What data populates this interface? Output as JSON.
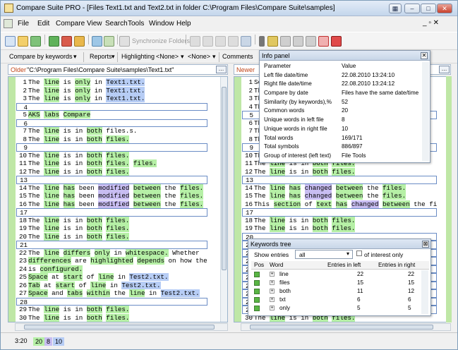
{
  "window": {
    "title": "Compare Suite PRO - [Files Text1.txt and Text2.txt in folder C:\\Program Files\\Compare Suite\\samples]"
  },
  "menu": [
    "File",
    "Edit",
    "Compare",
    "View",
    "Search",
    "Tools",
    "Window",
    "Help"
  ],
  "toolbar": {
    "sync_label": "Synchronize Folders"
  },
  "toolbar2": {
    "compare_by": "Compare by keywords",
    "reports": "Reports",
    "highlighting": "Highlighting",
    "none1": "<None>",
    "none2": "<None>",
    "comments": "Comments"
  },
  "left_path": {
    "label": "Older",
    "path": "\"C:\\Program Files\\Compare Suite\\samples\\Text1.txt\""
  },
  "right_path": {
    "label": "Newer"
  },
  "left_lines": [
    {
      "n": "1",
      "t": "The line is only in Text1.txt."
    },
    {
      "n": "2",
      "t": "The line is only in Text1.txt."
    },
    {
      "n": "3",
      "t": "The line is only in Text1.txt."
    },
    {
      "n": "4",
      "t": ""
    },
    {
      "n": "5",
      "t": "AKS labs Compare"
    },
    {
      "n": "6",
      "t": ""
    },
    {
      "n": "7",
      "t": "The line is in both files.s."
    },
    {
      "n": "8",
      "t": "The line is in both files."
    },
    {
      "n": "9",
      "t": ""
    },
    {
      "n": "10",
      "t": "The line is in both files."
    },
    {
      "n": "11",
      "t": "The line is in both files. files."
    },
    {
      "n": "12",
      "t": "The line is in both files."
    },
    {
      "n": "13",
      "t": ""
    },
    {
      "n": "14",
      "t": "The line has been modified between the files."
    },
    {
      "n": "15",
      "t": "The line has been modified between the files."
    },
    {
      "n": "16",
      "t": "The line has been modified between the files."
    },
    {
      "n": "17",
      "t": ""
    },
    {
      "n": "18",
      "t": "The line is in both files."
    },
    {
      "n": "19",
      "t": "The line is in both files."
    },
    {
      "n": "20",
      "t": "The line is in both files."
    },
    {
      "n": "21",
      "t": ""
    },
    {
      "n": "22",
      "t": "The line differs only in whitespace. Whether"
    },
    {
      "n": "23",
      "t": "differences are highlighted depends on how the"
    },
    {
      "n": "24",
      "t": "is configured."
    },
    {
      "n": "25",
      "t": "Space at start of line in Test2.txt."
    },
    {
      "n": "26",
      "t": "Tab at start of line in Test2.txt."
    },
    {
      "n": "27",
      "t": "Space and tabs within the line in Test2.txt."
    },
    {
      "n": "28",
      "t": ""
    },
    {
      "n": "29",
      "t": "The line is in both files."
    },
    {
      "n": "30",
      "t": "The line is in both files."
    }
  ],
  "right_lines": [
    {
      "n": "1",
      "t": "Sec"
    },
    {
      "n": "2",
      "t": "The"
    },
    {
      "n": "3",
      "t": "The"
    },
    {
      "n": "4",
      "t": "The"
    },
    {
      "n": "5",
      "t": ""
    },
    {
      "n": "6",
      "t": "The"
    },
    {
      "n": "7",
      "t": "The"
    },
    {
      "n": "8",
      "t": "The"
    },
    {
      "n": "9",
      "t": ""
    },
    {
      "n": "10",
      "t": "The"
    },
    {
      "n": "11",
      "t": "The line is in both files."
    },
    {
      "n": "12",
      "t": "The line is in both files."
    },
    {
      "n": "13",
      "t": ""
    },
    {
      "n": "14",
      "t": "The line has changed between the files."
    },
    {
      "n": "15",
      "t": "The line has changed between the files."
    },
    {
      "n": "16",
      "t": "This section of text has changed between the fi"
    },
    {
      "n": "17",
      "t": ""
    },
    {
      "n": "18",
      "t": "The line is in both files."
    },
    {
      "n": "19",
      "t": "The line is in both files."
    },
    {
      "n": "20",
      "t": ""
    },
    {
      "n": "21",
      "t": ""
    },
    {
      "n": "22",
      "t": ""
    },
    {
      "n": "23",
      "t": ""
    },
    {
      "n": "24",
      "t": ""
    },
    {
      "n": "25",
      "t": ""
    },
    {
      "n": "26",
      "t": ""
    },
    {
      "n": "27",
      "t": ""
    },
    {
      "n": "28",
      "t": ""
    },
    {
      "n": "29",
      "t": ""
    },
    {
      "n": "30",
      "t": "The line is in both files."
    }
  ],
  "info_panel": {
    "title": "Info panel",
    "col_param": "Parameter",
    "col_value": "Value",
    "rows": [
      [
        "Left file date/time",
        "22.08.2010 13:24:10"
      ],
      [
        "Right file date/time",
        "22.08.2010 13:24:12"
      ],
      [
        "Compare by date",
        "Files have the same date/time"
      ],
      [
        "Similarity (by keywords),%",
        "52"
      ],
      [
        "Common words",
        "20"
      ],
      [
        "Unique words in left file",
        "8"
      ],
      [
        "Unique words in right file",
        "10"
      ],
      [
        "Total words",
        "169/171"
      ],
      [
        "Total symbols",
        "886/897"
      ],
      [
        "Group of interest (left text)",
        "File Tools"
      ]
    ]
  },
  "keywords_tree": {
    "title": "Keywords tree",
    "show_entries_label": "Show entries",
    "show_entries_value": "all",
    "of_interest_label": "of interest only",
    "col_pos": "Pos",
    "col_word": "Word",
    "col_left": "Entries in left",
    "col_right": "Entries in right",
    "rows": [
      [
        "line",
        "22",
        "22"
      ],
      [
        "files",
        "15",
        "15"
      ],
      [
        "both",
        "11",
        "12"
      ],
      [
        "txt",
        "6",
        "6"
      ],
      [
        "only",
        "5",
        "5"
      ]
    ]
  },
  "status": {
    "pos": "3:20",
    "a": "20",
    "b": "8",
    "c": "10"
  }
}
